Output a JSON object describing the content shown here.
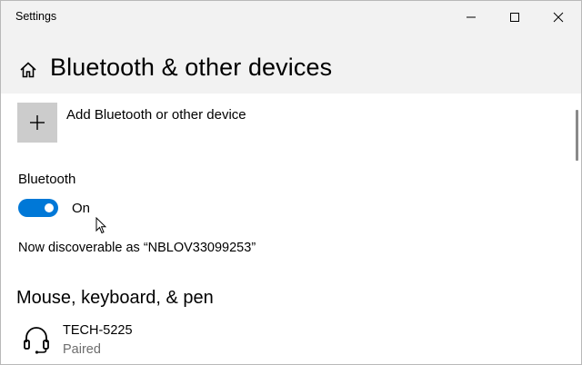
{
  "window": {
    "title": "Settings",
    "controls": {
      "minimize_icon": "minimize-icon",
      "maximize_icon": "maximize-icon",
      "close_icon": "close-icon"
    }
  },
  "header": {
    "home_icon": "home-icon",
    "page_title": "Bluetooth & other devices"
  },
  "add_device": {
    "icon": "plus-icon",
    "label": "Add Bluetooth or other device"
  },
  "bluetooth": {
    "section_label": "Bluetooth",
    "toggle_state": "On",
    "toggle_on": true,
    "discoverable_text": "Now discoverable as “NBLOV33099253”"
  },
  "sections": {
    "mouse_keyboard_pen": "Mouse, keyboard, & pen"
  },
  "devices": [
    {
      "icon": "headset-icon",
      "name": "TECH-5225",
      "status": "Paired"
    }
  ],
  "colors": {
    "accent": "#0078d7",
    "titlebar": "#f2f2f2",
    "add_tile": "#cccccc",
    "secondary_text": "#6d6d6d"
  }
}
